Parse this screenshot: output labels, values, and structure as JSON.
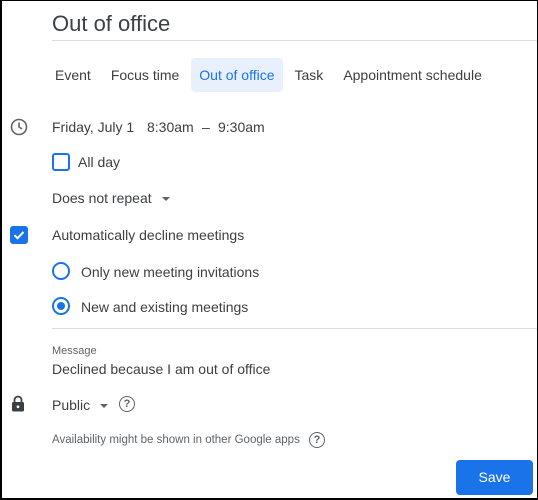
{
  "title": "Out of office",
  "tabs": [
    {
      "label": "Event",
      "active": false
    },
    {
      "label": "Focus time",
      "active": false
    },
    {
      "label": "Out of office",
      "active": true
    },
    {
      "label": "Task",
      "active": false
    },
    {
      "label": "Appointment schedule",
      "active": false
    }
  ],
  "datetime": {
    "date": "Friday, July 1",
    "start": "8:30am",
    "separator": "–",
    "end": "9:30am",
    "icon": "clock-icon"
  },
  "all_day": {
    "label": "All day",
    "checked": false
  },
  "repeat": {
    "value": "Does not repeat"
  },
  "decline": {
    "label": "Automatically decline meetings",
    "checked": true,
    "options": [
      {
        "label": "Only new meeting invitations",
        "selected": false
      },
      {
        "label": "New and existing meetings",
        "selected": true
      }
    ]
  },
  "message": {
    "label": "Message",
    "value": "Declined because I am out of office"
  },
  "visibility": {
    "value": "Public",
    "icon": "lock-icon",
    "help": "?"
  },
  "availability_note": {
    "text": "Availability might be shown in other Google apps",
    "help": "?"
  },
  "save_label": "Save",
  "colors": {
    "accent": "#1a73e8",
    "tab_active_bg": "#e8f0fe",
    "text": "#3c4043"
  }
}
